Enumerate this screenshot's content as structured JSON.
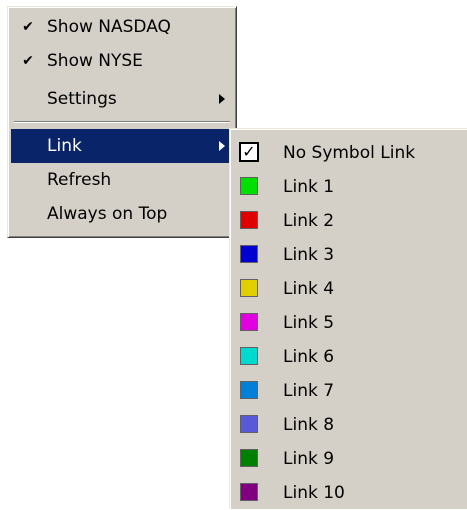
{
  "main_menu": {
    "items": [
      {
        "label": "Show NASDAQ",
        "checked": true
      },
      {
        "label": "Show NYSE",
        "checked": true
      },
      {
        "label": "Settings",
        "has_submenu": true
      },
      {
        "label": "Link",
        "has_submenu": true,
        "selected": true
      },
      {
        "label": "Refresh"
      },
      {
        "label": "Always on Top"
      }
    ],
    "check_glyph": "✔"
  },
  "link_menu": {
    "items": [
      {
        "label": "No Symbol Link",
        "checked": true
      },
      {
        "label": "Link 1",
        "color": "#00e000"
      },
      {
        "label": "Link 2",
        "color": "#e00000"
      },
      {
        "label": "Link 3",
        "color": "#0000d0"
      },
      {
        "label": "Link 4",
        "color": "#e0d000"
      },
      {
        "label": "Link 5",
        "color": "#e000e0"
      },
      {
        "label": "Link 6",
        "color": "#00d8d0"
      },
      {
        "label": "Link 7",
        "color": "#0080d8"
      },
      {
        "label": "Link 8",
        "color": "#5858d8"
      },
      {
        "label": "Link 9",
        "color": "#008000"
      },
      {
        "label": "Link 10",
        "color": "#800080"
      }
    ],
    "check_glyph": "✓"
  },
  "colors": {
    "menu_face": "#d4d0c8",
    "highlight": "#0a246a",
    "highlight_text": "#ffffff"
  }
}
